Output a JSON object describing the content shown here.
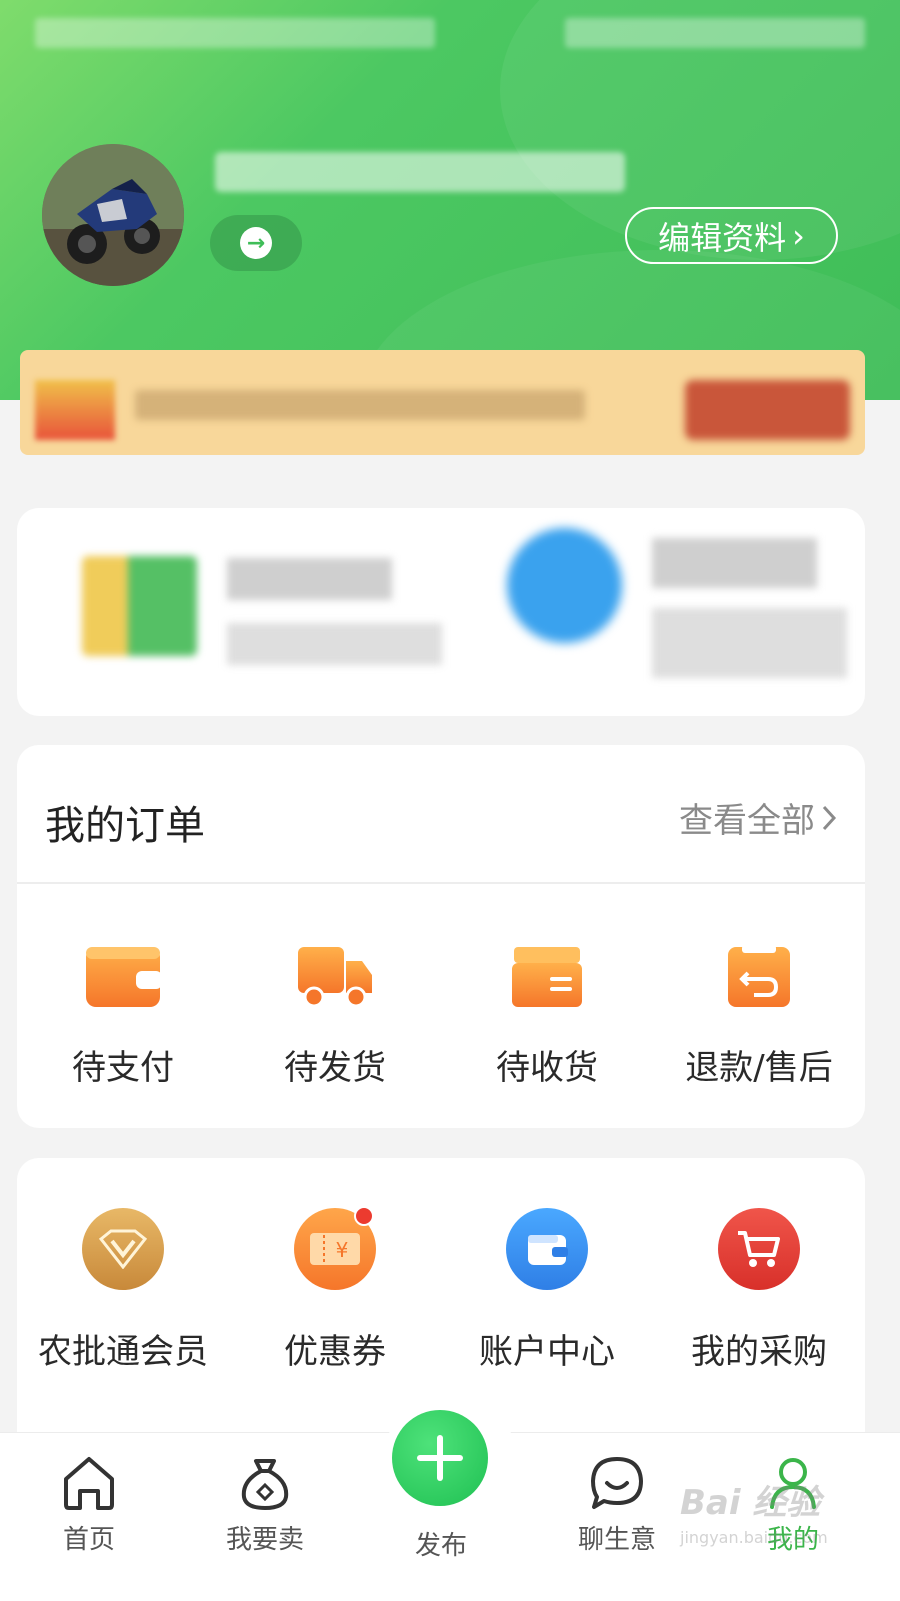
{
  "profile": {
    "edit_button_label": "编辑资料",
    "edit_chevron": "›"
  },
  "orders": {
    "title": "我的订单",
    "view_all_label": "查看全部",
    "items": [
      {
        "label": "待支付",
        "icon": "wallet-icon"
      },
      {
        "label": "待发货",
        "icon": "truck-icon"
      },
      {
        "label": "待收货",
        "icon": "box-icon"
      },
      {
        "label": "退款/售后",
        "icon": "return-icon"
      }
    ]
  },
  "tools": {
    "items": [
      {
        "label": "农批通会员",
        "icon": "vip-diamond-icon"
      },
      {
        "label": "优惠券",
        "icon": "coupon-icon"
      },
      {
        "label": "账户中心",
        "icon": "account-wallet-icon"
      },
      {
        "label": "我的采购",
        "icon": "cart-icon"
      }
    ]
  },
  "tabbar": {
    "items": [
      {
        "label": "首页",
        "icon": "home-icon"
      },
      {
        "label": "我要卖",
        "icon": "money-bag-icon"
      },
      {
        "label": "发布",
        "icon": "plus-icon"
      },
      {
        "label": "聊生意",
        "icon": "chat-icon"
      },
      {
        "label": "我的",
        "icon": "user-icon",
        "active": true
      }
    ]
  },
  "watermark": {
    "text": "Bai 经验",
    "subtext": "jingyan.baidu.com"
  },
  "colors": {
    "header_green": "#4cc862",
    "accent_orange": "#f58a2e",
    "active_tab_green": "#3bb54a",
    "publish_green": "#1fc052"
  }
}
